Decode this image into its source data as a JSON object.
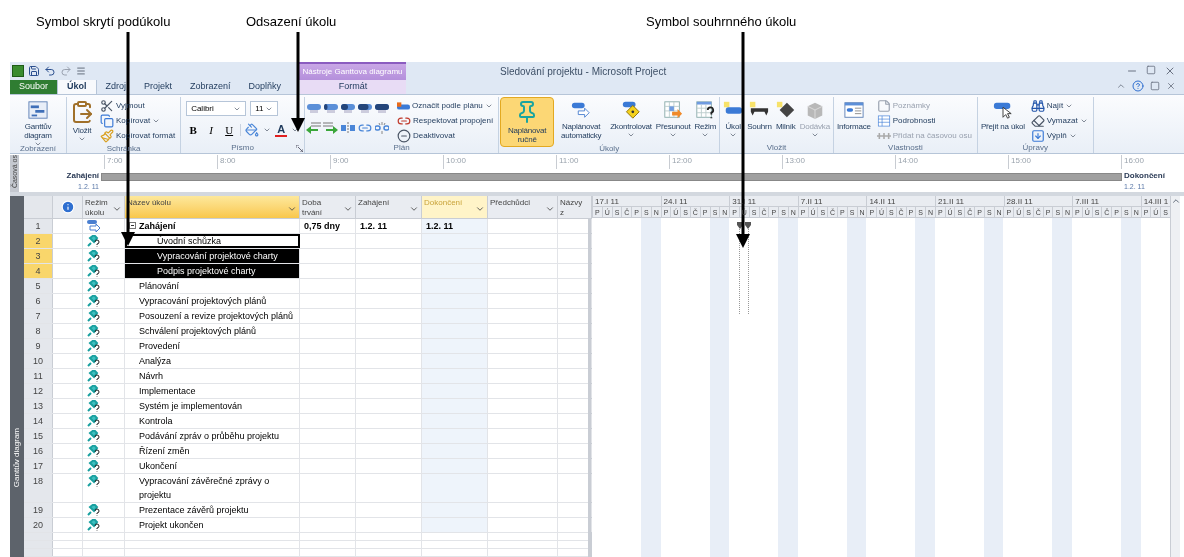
{
  "annotations": [
    {
      "text": "Symbol skrytí podúkolu"
    },
    {
      "text": "Odsazení úkolu"
    },
    {
      "text": "Symbol souhrnného úkolu"
    }
  ],
  "window": {
    "title": "Sledování projektu - Microsoft Project",
    "contextual_group": "Nástroje Ganttova diagramu"
  },
  "tabs": [
    {
      "label": "Soubor",
      "kind": "file",
      "selected": false
    },
    {
      "label": "Úkol",
      "kind": "normal",
      "selected": true
    },
    {
      "label": "Zdroj",
      "kind": "normal",
      "selected": false
    },
    {
      "label": "Projekt",
      "kind": "normal",
      "selected": false
    },
    {
      "label": "Zobrazení",
      "kind": "normal",
      "selected": false
    },
    {
      "label": "Doplňky",
      "kind": "normal",
      "selected": false
    },
    {
      "label": "Formát",
      "kind": "contextual",
      "selected": false
    }
  ],
  "ribbon": [
    {
      "label": "Zobrazení",
      "items": [
        {
          "kind": "large",
          "label": "Ganttův diagram",
          "dropdown": true
        }
      ]
    },
    {
      "label": "Schránka",
      "items": [
        {
          "kind": "large",
          "label": "Vložit",
          "dropdown": true
        },
        {
          "kind": "small",
          "label": "Vyjmout",
          "dropdown": false
        },
        {
          "kind": "small",
          "label": "Kopírovat",
          "dropdown": true
        },
        {
          "kind": "small",
          "label": "Kopírovat formát",
          "dropdown": false
        }
      ]
    },
    {
      "label": "Písmo",
      "launcher": true,
      "items": [
        {
          "kind": "font",
          "font": "Calibri",
          "size": "11",
          "bold": "B",
          "italic": "I",
          "underline": "U",
          "color_letter": "A"
        }
      ]
    },
    {
      "label": "Plán",
      "items": [
        {
          "kind": "icon-grid"
        },
        {
          "kind": "small",
          "label": "Označit podle plánu",
          "dropdown": true
        },
        {
          "kind": "small",
          "label": "Respektovat propojení",
          "dropdown": false
        },
        {
          "kind": "small",
          "label": "Deaktivovat",
          "dropdown": false
        }
      ]
    },
    {
      "label": "Úkoly",
      "items": [
        {
          "kind": "large",
          "label": "Naplánovat ručně",
          "selected": true,
          "dropdown": false
        },
        {
          "kind": "large",
          "label": "Naplánovat automaticky",
          "selected": false,
          "dropdown": false
        },
        {
          "kind": "large",
          "label": "Zkontrolovat",
          "selected": false,
          "dropdown": true
        },
        {
          "kind": "large",
          "label": "Přesunout",
          "selected": false,
          "dropdown": true
        },
        {
          "kind": "large",
          "label": "Režim",
          "selected": false,
          "dropdown": true
        }
      ]
    },
    {
      "label": "Vložit",
      "items": [
        {
          "kind": "large",
          "label": "Úkol",
          "disabled": false,
          "dropdown": true
        },
        {
          "kind": "large",
          "label": "Souhrn",
          "disabled": false,
          "dropdown": false
        },
        {
          "kind": "large",
          "label": "Milník",
          "disabled": false,
          "dropdown": false
        },
        {
          "kind": "large",
          "label": "Dodávka",
          "disabled": true,
          "dropdown": true
        }
      ]
    },
    {
      "label": "Vlastnosti",
      "items": [
        {
          "kind": "large",
          "label": "Informace",
          "disabled": false,
          "dropdown": false
        },
        {
          "kind": "small",
          "label": "Poznámky",
          "disabled": true,
          "dropdown": false
        },
        {
          "kind": "small",
          "label": "Podrobnosti",
          "disabled": false,
          "dropdown": false
        },
        {
          "kind": "small",
          "label": "Přidat na časovou osu",
          "disabled": true,
          "dropdown": false
        }
      ]
    },
    {
      "label": "Úpravy",
      "items": [
        {
          "kind": "large",
          "label": "Přejít na úkol",
          "dropdown": false
        },
        {
          "kind": "small",
          "label": "Najít",
          "dropdown": true
        },
        {
          "kind": "small",
          "label": "Vymazat",
          "dropdown": true
        },
        {
          "kind": "small",
          "label": "Výplň",
          "dropdown": true
        }
      ]
    }
  ],
  "timeline": {
    "side_label": "Časová os",
    "ticks": [
      "7:00",
      "8:00",
      "9:00",
      "10:00",
      "11:00",
      "12:00",
      "13:00",
      "14:00",
      "15:00",
      "16:00"
    ],
    "start": {
      "label": "Zahájení",
      "date": "1.2. 11"
    },
    "finish": {
      "label": "Dokončení",
      "date": "1.2. 11"
    }
  },
  "table": {
    "view_label": "Ganttův diagram",
    "columns": [
      {
        "label": "Režim úkolu",
        "selected": false,
        "hovered": false
      },
      {
        "label": "Název úkolu",
        "selected": true,
        "hovered": false
      },
      {
        "label": "Doba trvání",
        "selected": false,
        "hovered": false
      },
      {
        "label": "Zahájení",
        "selected": false,
        "hovered": false
      },
      {
        "label": "Dokončení",
        "selected": false,
        "hovered": true
      },
      {
        "label": "Předchůdci",
        "selected": false,
        "hovered": false
      },
      {
        "label": "Názvy z",
        "selected": false,
        "hovered": false
      }
    ],
    "rows": [
      {
        "id": "1",
        "name": "Zahájení",
        "kind": "auto_scheduled",
        "summary": true,
        "expanded": true,
        "duration": "0,75 dny",
        "start": "1.2. 11",
        "finish": "1.2. 11",
        "selected": false,
        "active": false,
        "children": [
          {
            "id": "2",
            "name": "Úvodní schůzka",
            "kind": "manually_scheduled",
            "summary": false,
            "selected": true,
            "active": true
          },
          {
            "id": "3",
            "name": "Vypracování projektové charty",
            "kind": "manually_scheduled",
            "summary": false,
            "selected": true,
            "active": false
          },
          {
            "id": "4",
            "name": "Podpis projektové charty",
            "kind": "manually_scheduled",
            "summary": false,
            "selected": true,
            "active": false
          }
        ]
      },
      {
        "id": "5",
        "name": "Plánování",
        "kind": "manually_scheduled",
        "summary": false,
        "selected": false,
        "active": false
      },
      {
        "id": "6",
        "name": "Vypracování projektových plánů",
        "kind": "manually_scheduled",
        "summary": false,
        "selected": false,
        "active": false
      },
      {
        "id": "7",
        "name": "Posouzení a revize projektových plánů",
        "kind": "manually_scheduled",
        "summary": false,
        "selected": false,
        "active": false
      },
      {
        "id": "8",
        "name": "Schválení projektových plánů",
        "kind": "manually_scheduled",
        "summary": false,
        "selected": false,
        "active": false
      },
      {
        "id": "9",
        "name": "Provedení",
        "kind": "manually_scheduled",
        "summary": false,
        "selected": false,
        "active": false
      },
      {
        "id": "10",
        "name": "Analýza",
        "kind": "manually_scheduled",
        "summary": false,
        "selected": false,
        "active": false
      },
      {
        "id": "11",
        "name": "Návrh",
        "kind": "manually_scheduled",
        "summary": false,
        "selected": false,
        "active": false
      },
      {
        "id": "12",
        "name": "Implementace",
        "kind": "manually_scheduled",
        "summary": false,
        "selected": false,
        "active": false
      },
      {
        "id": "13",
        "name": "Systém je implementován",
        "kind": "manually_scheduled",
        "summary": false,
        "selected": false,
        "active": false
      },
      {
        "id": "14",
        "name": "Kontrola",
        "kind": "manually_scheduled",
        "summary": false,
        "selected": false,
        "active": false
      },
      {
        "id": "15",
        "name": "Podávání zpráv o průběhu projektu",
        "kind": "manually_scheduled",
        "summary": false,
        "selected": false,
        "active": false
      },
      {
        "id": "16",
        "name": "Řízení změn",
        "kind": "manually_scheduled",
        "summary": false,
        "selected": false,
        "active": false
      },
      {
        "id": "17",
        "name": "Ukončení",
        "kind": "manually_scheduled",
        "summary": false,
        "selected": false,
        "active": false
      },
      {
        "id": "18",
        "name": "Vypracování závěrečné zprávy o projektu",
        "kind": "manually_scheduled",
        "summary": false,
        "selected": false,
        "active": false
      },
      {
        "id": "19",
        "name": "Prezentace závěrů projektu",
        "kind": "manually_scheduled",
        "summary": false,
        "selected": false,
        "active": false
      },
      {
        "id": "20",
        "name": "Projekt ukončen",
        "kind": "manually_scheduled",
        "summary": false,
        "selected": false,
        "active": false
      }
    ]
  },
  "gantt": {
    "weeks": [
      {
        "label": "17.I 11",
        "days": [
          "P",
          "Ú",
          "S",
          "Č",
          "P",
          "S",
          "N"
        ]
      },
      {
        "label": "24.I 11",
        "days": [
          "P",
          "Ú",
          "S",
          "Č",
          "P",
          "S",
          "N"
        ]
      },
      {
        "label": "31.I 11",
        "days": [
          "P",
          "Ú",
          "S",
          "Č",
          "P",
          "S",
          "N"
        ]
      },
      {
        "label": "7.II 11",
        "days": [
          "P",
          "Ú",
          "S",
          "Č",
          "P",
          "S",
          "N"
        ]
      },
      {
        "label": "14.II 11",
        "days": [
          "P",
          "Ú",
          "S",
          "Č",
          "P",
          "S",
          "N"
        ]
      },
      {
        "label": "21.II 11",
        "days": [
          "P",
          "Ú",
          "S",
          "Č",
          "P",
          "S",
          "N"
        ]
      },
      {
        "label": "28.II 11",
        "days": [
          "P",
          "Ú",
          "S",
          "Č",
          "P",
          "S",
          "N"
        ]
      },
      {
        "label": "7.III 11",
        "days": [
          "P",
          "Ú",
          "S",
          "Č",
          "P",
          "S",
          "N"
        ]
      },
      {
        "label": "14.III 1",
        "days": [
          "P",
          "Ú",
          "S"
        ]
      }
    ]
  }
}
